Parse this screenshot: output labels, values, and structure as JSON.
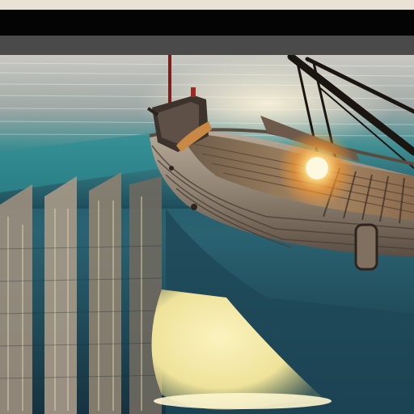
{
  "header": {
    "left_text": "",
    "right_text": ""
  },
  "scene": {
    "subject": "wooden-boat",
    "colors": {
      "water_light": "#d9d6cc",
      "water_teal": "#2f8f96",
      "water_dark": "#173a4a",
      "hull": "#8a7b6c",
      "hull_dark": "#3a2e26",
      "sun": "#ffcf63",
      "reflection": "#f4eaa8"
    }
  }
}
